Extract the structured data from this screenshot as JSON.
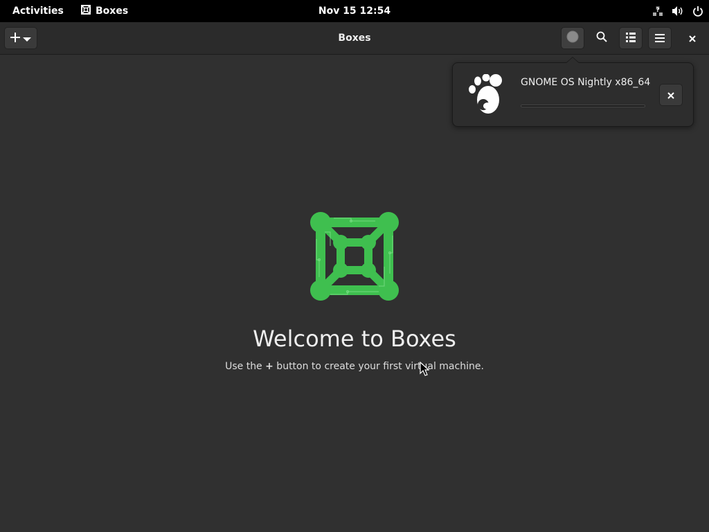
{
  "topbar": {
    "activities": "Activities",
    "app_name": "Boxes",
    "clock": "Nov 15  12:54"
  },
  "headerbar": {
    "title": "Boxes"
  },
  "notification": {
    "os_name": "GNOME OS Nightly x86_64",
    "progress": 0.0,
    "accent_color": "#3584e4"
  },
  "welcome": {
    "title": "Welcome to Boxes",
    "subtitle_before": "Use the ",
    "subtitle_plus": "+",
    "subtitle_after": " button to create your first virtual machine."
  },
  "colors": {
    "logo_green": "#3fbf4f",
    "background": "#303030"
  }
}
